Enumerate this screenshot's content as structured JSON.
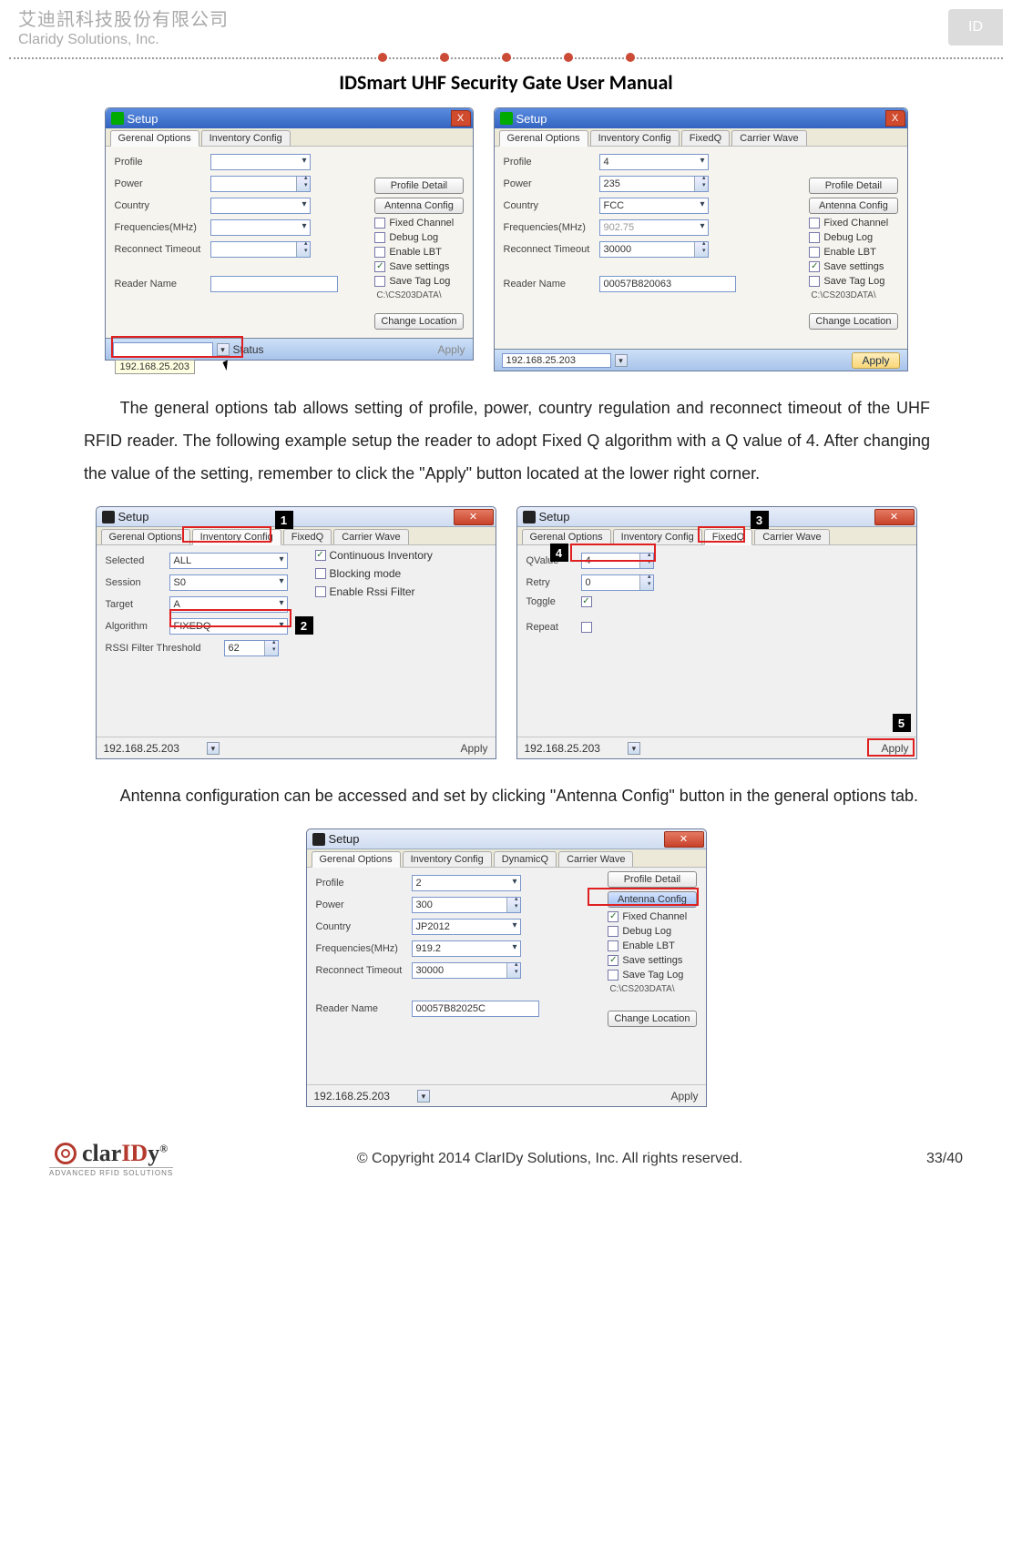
{
  "header": {
    "company_cn": "艾迪訊科技股份有限公司",
    "company_en": "Claridy Solutions, Inc.",
    "logo_text": "ID"
  },
  "doc_title": "IDSmart UHF Security Gate User Manual",
  "body": {
    "p1": "The general options tab allows setting of profile, power, country regulation and reconnect timeout of the UHF RFID reader. The following example setup the reader to adopt Fixed Q algorithm with a Q value of 4. After changing the value of the setting, remember to click the \"Apply\" button located at the lower right corner.",
    "p2": "Antenna configuration can be accessed and set by clicking \"Antenna Config\" button in the general options tab."
  },
  "common": {
    "setup_title": "Setup",
    "status_label": "Status",
    "apply_label": "Apply",
    "ip": "192.168.25.203"
  },
  "labels": {
    "profile": "Profile",
    "power": "Power",
    "country": "Country",
    "freq": "Frequencies(MHz)",
    "reconnect": "Reconnect Timeout",
    "reader_name": "Reader Name",
    "selected": "Selected",
    "session": "Session",
    "target": "Target",
    "algorithm": "Algorithm",
    "rssi_thresh": "RSSI Filter Threshold",
    "qvalue": "QValue",
    "retry": "Retry",
    "toggle": "Toggle",
    "repeat": "Repeat"
  },
  "tabs": {
    "general": "Gerenal Options",
    "inventory": "Inventory Config",
    "fixedq": "FixedQ",
    "dynamicq": "DynamicQ",
    "carrier": "Carrier Wave"
  },
  "buttons": {
    "profile_detail": "Profile Detail",
    "antenna_config": "Antenna Config",
    "change_location": "Change Location"
  },
  "checks": {
    "fixed_channel": "Fixed Channel",
    "debug_log": "Debug Log",
    "enable_lbt": "Enable LBT",
    "save_settings": "Save settings",
    "save_tag_log": "Save Tag Log",
    "cont_inv": "Continuous Inventory",
    "blocking": "Blocking mode",
    "rssi_filter": "Enable Rssi Filter"
  },
  "win_a": {
    "path": "C:\\CS203DATA\\"
  },
  "win_b": {
    "profile": "4",
    "power": "235",
    "country": "FCC",
    "freq": "902.75",
    "reconnect": "30000",
    "reader_name": "00057B820063",
    "path": "C:\\CS203DATA\\"
  },
  "win_c": {
    "selected": "ALL",
    "session": "S0",
    "target": "A",
    "algorithm": "FIXEDQ",
    "rssi": "62"
  },
  "win_d": {
    "qvalue": "4",
    "retry": "0"
  },
  "win_e": {
    "profile": "2",
    "power": "300",
    "country": "JP2012",
    "freq": "919.2",
    "reconnect": "30000",
    "reader_name": "00057B82025C",
    "path": "C:\\CS203DATA\\"
  },
  "callouts": {
    "n1": "1",
    "n2": "2",
    "n3": "3",
    "n4": "4",
    "n5": "5"
  },
  "footer": {
    "copyright": "© Copyright 2014 ClarIDy Solutions, Inc. All rights reserved.",
    "pagination": "33/40",
    "brand_top_pre": "clar",
    "brand_top_red": "ID",
    "brand_top_post": "y",
    "brand_reg": "®",
    "brand_sub": "ADVANCED RFID SOLUTIONS"
  }
}
